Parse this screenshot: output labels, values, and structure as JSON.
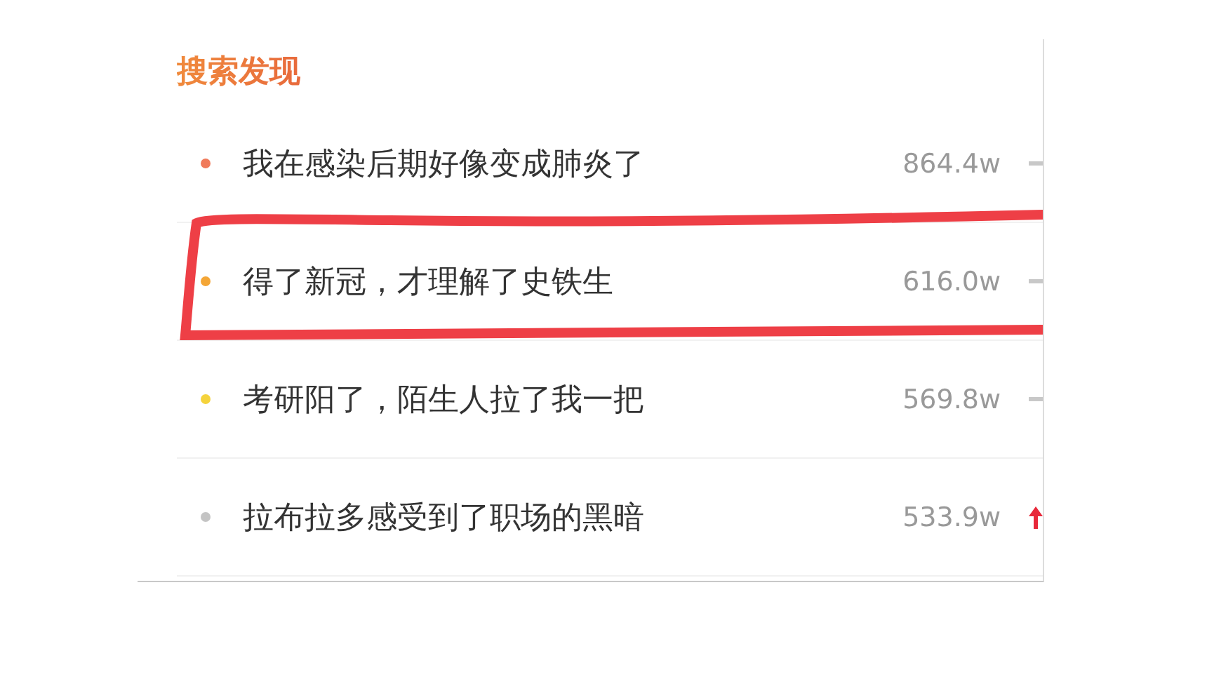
{
  "section": {
    "title": "搜索发现"
  },
  "items": [
    {
      "text": "我在感染后期好像变成肺炎了",
      "count": "864.4w",
      "color": "#f07a5a",
      "kind": "flat",
      "highlighted": false
    },
    {
      "text": "得了新冠，才理解了史铁生",
      "count": "616.0w",
      "color": "#f4a636",
      "kind": "flat",
      "highlighted": true
    },
    {
      "text": "考研阳了，陌生人拉了我一把",
      "count": "569.8w",
      "color": "#f5d33c",
      "kind": "flat",
      "highlighted": false
    },
    {
      "text": "拉布拉多感受到了职场的黑暗",
      "count": "533.9w",
      "color": "#c4c4c4",
      "kind": "up",
      "highlighted": false
    }
  ]
}
